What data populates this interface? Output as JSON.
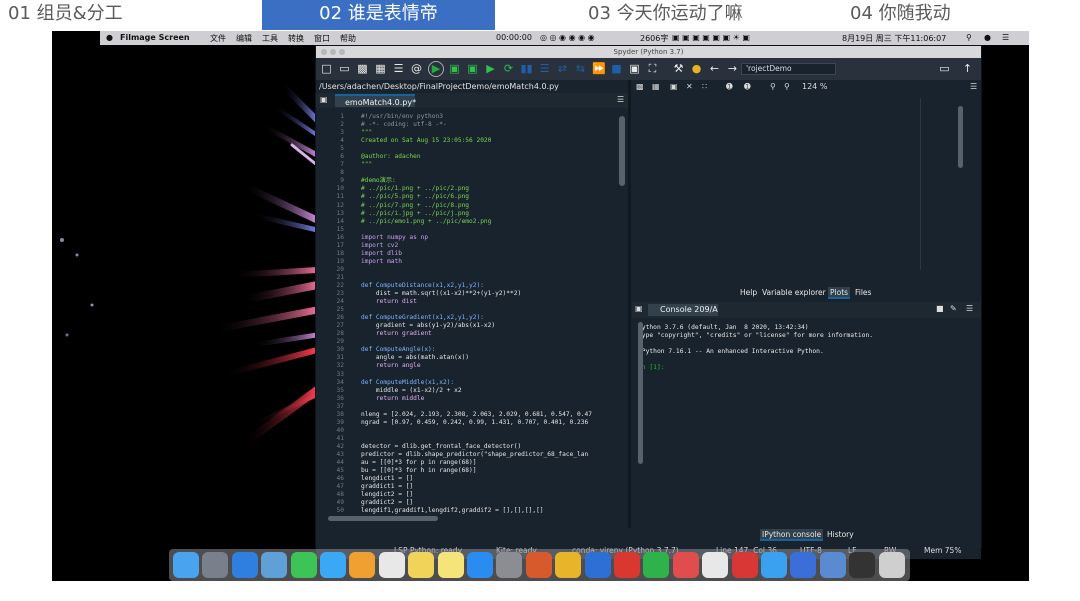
{
  "tabs": [
    {
      "label": "01 组员&分工"
    },
    {
      "label": "02 谁是表情帝"
    },
    {
      "label": "03 今天你运动了嘛"
    },
    {
      "label": "04 你随我动"
    }
  ],
  "mac_menu": {
    "app": "Filmage Screen",
    "items": [
      "文件",
      "编辑",
      "工具",
      "转换",
      "窗口",
      "帮助"
    ],
    "timer": "00:00:00",
    "status_text": "2606字",
    "datetime": "8月19日 周三 下午11:06:07"
  },
  "spyder": {
    "window_title": "Spyder (Python 3.7)",
    "path_box": "'rojectDemo",
    "file_path": "/Users/adachen/Desktop/FinalProjectDemo/emoMatch4.0.py",
    "editor_tab": "emoMatch4.0.py*",
    "code_lines": [
      {
        "n": "1",
        "t": "#!/usr/bin/env python3"
      },
      {
        "n": "2",
        "t": "# -*- coding: utf-8 -*-"
      },
      {
        "n": "3",
        "t": "\"\"\""
      },
      {
        "n": "4",
        "t": "Created on Sat Aug 15 23:05:56 2020"
      },
      {
        "n": "5",
        "t": ""
      },
      {
        "n": "6",
        "t": "@author: adachen"
      },
      {
        "n": "7",
        "t": "\"\"\""
      },
      {
        "n": "8",
        "t": ""
      },
      {
        "n": "9",
        "t": "#demo演示:"
      },
      {
        "n": "10",
        "t": "# ../pic/1.png + ../pic/2.png"
      },
      {
        "n": "11",
        "t": "# ../pic/5.png + ../pic/6.png"
      },
      {
        "n": "12",
        "t": "# ../pic/7.png + ../pic/8.png"
      },
      {
        "n": "13",
        "t": "# ../pic/i.jpg + ../pic/j.png"
      },
      {
        "n": "14",
        "t": "# ../pic/emo1.png + ../pic/emo2.png"
      },
      {
        "n": "15",
        "t": ""
      },
      {
        "n": "16",
        "t": "import numpy as np"
      },
      {
        "n": "17",
        "t": "import cv2"
      },
      {
        "n": "18",
        "t": "import dlib"
      },
      {
        "n": "19",
        "t": "import math"
      },
      {
        "n": "20",
        "t": ""
      },
      {
        "n": "21",
        "t": ""
      },
      {
        "n": "22",
        "t": "def ComputeDistance(x1,x2,y1,y2):"
      },
      {
        "n": "23",
        "t": "    dist = math.sqrt((x1-x2)**2+(y1-y2)**2)"
      },
      {
        "n": "24",
        "t": "    return dist"
      },
      {
        "n": "25",
        "t": ""
      },
      {
        "n": "26",
        "t": "def ComputeGradient(x1,x2,y1,y2):"
      },
      {
        "n": "27",
        "t": "    gradient = abs(y1-y2)/abs(x1-x2)"
      },
      {
        "n": "28",
        "t": "    return gradient"
      },
      {
        "n": "29",
        "t": ""
      },
      {
        "n": "30",
        "t": "def ComputeAngle(x):"
      },
      {
        "n": "31",
        "t": "    angle = abs(math.atan(x))"
      },
      {
        "n": "32",
        "t": "    return angle"
      },
      {
        "n": "33",
        "t": ""
      },
      {
        "n": "34",
        "t": "def ComputeMiddle(x1,x2):"
      },
      {
        "n": "35",
        "t": "    middle = (x1-x2)/2 + x2"
      },
      {
        "n": "36",
        "t": "    return middle"
      },
      {
        "n": "37",
        "t": ""
      },
      {
        "n": "38",
        "t": "nleng = [2.024, 2.193, 2.308, 2.063, 2.029, 0.681, 0.547, 0.47"
      },
      {
        "n": "39",
        "t": "ngrad = [0.97, 0.459, 0.242, 0.99, 1.431, 0.707, 0.401, 0.236"
      },
      {
        "n": "40",
        "t": ""
      },
      {
        "n": "41",
        "t": ""
      },
      {
        "n": "42",
        "t": "detector = dlib.get_frontal_face_detector()"
      },
      {
        "n": "43",
        "t": "predictor = dlib.shape_predictor(\"shape_predictor_68_face_lan"
      },
      {
        "n": "44",
        "t": "au = [[0]*3 for p in range(68)]"
      },
      {
        "n": "45",
        "t": "bu = [[0]*3 for h in range(68)]"
      },
      {
        "n": "46",
        "t": "lengdict1 = []"
      },
      {
        "n": "47",
        "t": "graddict1 = []"
      },
      {
        "n": "48",
        "t": "lengdict2 = []"
      },
      {
        "n": "49",
        "t": "graddict2 = []"
      },
      {
        "n": "50",
        "t": "lengdif1,graddif1,lengdif2,graddif2 = [],[],[],[]"
      }
    ],
    "right_toolbar": {
      "zoom": "124 %"
    },
    "pane_tabs": [
      "Help",
      "Variable explorer",
      "Plots",
      "Files"
    ],
    "console_tab": "Console 209/A",
    "console_lines": [
      "Python 3.7.6 (default, Jan  8 2020, 13:42:34)",
      "Type \"copyright\", \"credits\" or \"license\" for more information.",
      "",
      "IPython 7.16.1 -- An enhanced Interactive Python.",
      "",
      "In [1]:"
    ],
    "console_bottom_tabs": [
      "IPython console",
      "History"
    ],
    "status": {
      "lsp": "LSP Python: ready",
      "kite": "Kite: ready",
      "conda": "conda: virenv (Python 3.7.7)",
      "position": "Line 147, Col 36",
      "encoding": "UTF-8",
      "eol": "LF",
      "mode": "RW",
      "mem": "Mem 75%"
    }
  },
  "dock_apps": [
    "finder",
    "launchpad",
    "safari",
    "preview",
    "facetime",
    "messages",
    "photos",
    "calendar",
    "notes",
    "stickies",
    "app-store",
    "settings",
    "powerpoint",
    "chrome",
    "word",
    "netease",
    "wechat",
    "bowtie",
    "music",
    "pdf",
    "maps",
    "xcode",
    "screenshots",
    "terminal",
    "trash"
  ],
  "colors": {
    "accent": "#3a6fc4",
    "spyder_bg": "#19232d",
    "tab_highlight": "#1464a0"
  }
}
